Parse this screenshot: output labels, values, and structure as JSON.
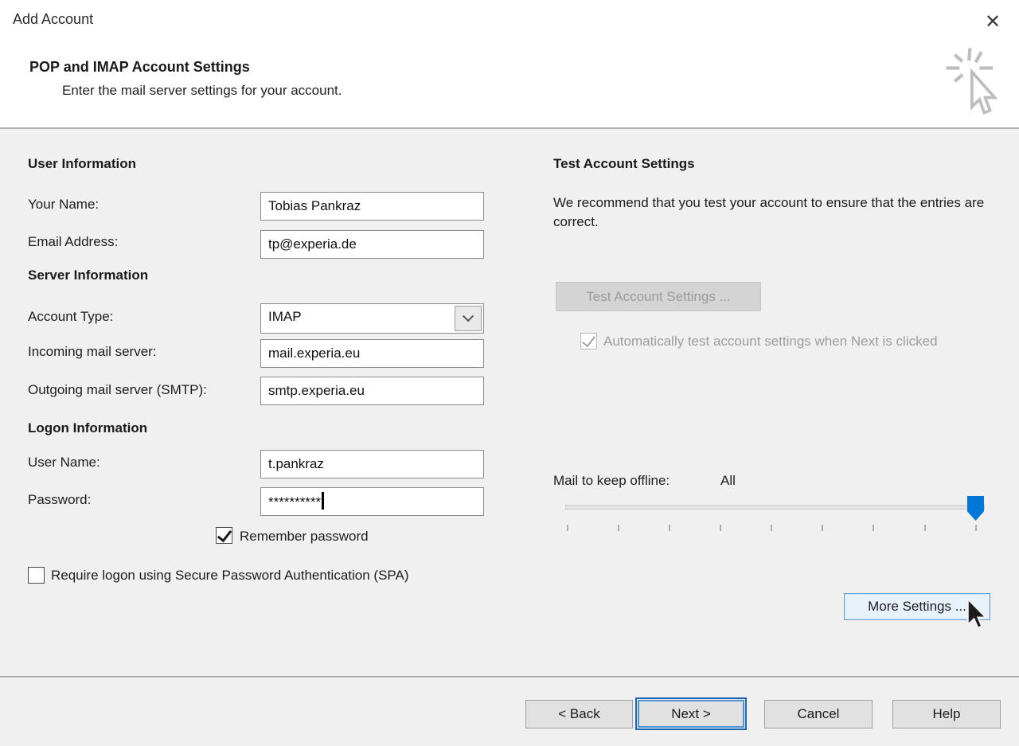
{
  "window": {
    "title": "Add Account",
    "close_glyph": "✕"
  },
  "header": {
    "title": "POP and IMAP Account Settings",
    "subtitle": "Enter the mail server settings for your account."
  },
  "user_information": {
    "heading": "User Information",
    "your_name": {
      "label": "Your Name:",
      "value": "Tobias Pankraz"
    },
    "email_address": {
      "label": "Email Address:",
      "value": "tp@experia.de"
    }
  },
  "server_information": {
    "heading": "Server Information",
    "account_type": {
      "label": "Account Type:",
      "value": "IMAP"
    },
    "incoming_mail_server": {
      "label": "Incoming mail server:",
      "value": "mail.experia.eu"
    },
    "outgoing_mail_server": {
      "label": "Outgoing mail server (SMTP):",
      "value": "smtp.experia.eu"
    }
  },
  "logon_information": {
    "heading": "Logon Information",
    "user_name": {
      "label": "User Name:",
      "value": "t.pankraz"
    },
    "password": {
      "label": "Password:",
      "value": "**********",
      "caret_visible": true
    },
    "remember_password": {
      "label": "Remember password",
      "checked": true
    },
    "spa": {
      "label": "Require logon using Secure Password Authentication (SPA)",
      "checked": false
    }
  },
  "test_account": {
    "heading": "Test Account Settings",
    "description": "We recommend that you test your account to ensure that the entries are correct.",
    "button_label": "Test Account Settings ...",
    "button_enabled": false,
    "auto_test": {
      "label": "Automatically test account settings when Next is clicked",
      "checked": true,
      "enabled": false
    }
  },
  "offline_mail": {
    "label": "Mail to keep offline:",
    "value": "All",
    "slider_position": "max",
    "tick_count": 9
  },
  "more_settings": {
    "label": "More Settings ...",
    "hovered": true
  },
  "footer": {
    "back_label": "< Back",
    "next_label": "Next >",
    "cancel_label": "Cancel",
    "help_label": "Help"
  },
  "colors": {
    "accent_blue": "#0078d7",
    "next_button_border": "#2265b0",
    "hover_button_border": "#66a0d4",
    "content_background": "#f0f0f0",
    "header_background": "#ffffff",
    "disabled_text": "#9b9b9b"
  }
}
